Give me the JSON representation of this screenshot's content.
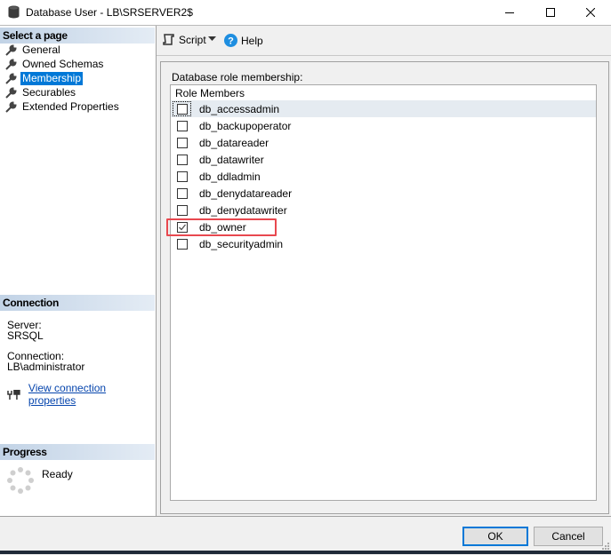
{
  "window": {
    "title": "Database User - LB\\SRSERVER2$",
    "icon": "database-icon",
    "controls": [
      "minimize-icon",
      "maximize-icon",
      "close-icon"
    ]
  },
  "left_pane": {
    "select_page_header": "Select a page",
    "pages": [
      {
        "label": "General",
        "icon": "wrench-icon",
        "selected": false
      },
      {
        "label": "Owned Schemas",
        "icon": "wrench-icon",
        "selected": false
      },
      {
        "label": "Membership",
        "icon": "wrench-icon",
        "selected": true
      },
      {
        "label": "Securables",
        "icon": "wrench-icon",
        "selected": false
      },
      {
        "label": "Extended Properties",
        "icon": "wrench-icon",
        "selected": false
      }
    ],
    "connection": {
      "header": "Connection",
      "server_label": "Server:",
      "server_value": "SRSQL",
      "connection_label": "Connection:",
      "connection_value": "LB\\administrator",
      "link_icon": "connection-plug-icon",
      "link_text": "View connection properties"
    },
    "progress": {
      "header": "Progress",
      "icon": "spinner-icon",
      "status": "Ready"
    }
  },
  "toolbar": {
    "script_label": "Script",
    "script_icon": "script-icon",
    "dropdown_icon": "chevron-down-icon",
    "help_label": "Help",
    "help_icon": "help-icon"
  },
  "membership": {
    "group_label": "Database role membership:",
    "column_header": "Role Members",
    "roles": [
      {
        "name": "db_accessadmin",
        "checked": false
      },
      {
        "name": "db_backupoperator",
        "checked": false
      },
      {
        "name": "db_datareader",
        "checked": false
      },
      {
        "name": "db_datawriter",
        "checked": false
      },
      {
        "name": "db_ddladmin",
        "checked": false
      },
      {
        "name": "db_denydatareader",
        "checked": false
      },
      {
        "name": "db_denydatawriter",
        "checked": false
      },
      {
        "name": "db_owner",
        "checked": true
      },
      {
        "name": "db_securityadmin",
        "checked": false
      }
    ],
    "annotation_color": "#e8484f"
  },
  "buttons": {
    "ok": "OK",
    "cancel": "Cancel"
  },
  "colors": {
    "accent": "#0078d7",
    "link": "#0645ad",
    "header_gradient_start": "#c2d3e6",
    "row_highlight": "#e5ebf1"
  }
}
